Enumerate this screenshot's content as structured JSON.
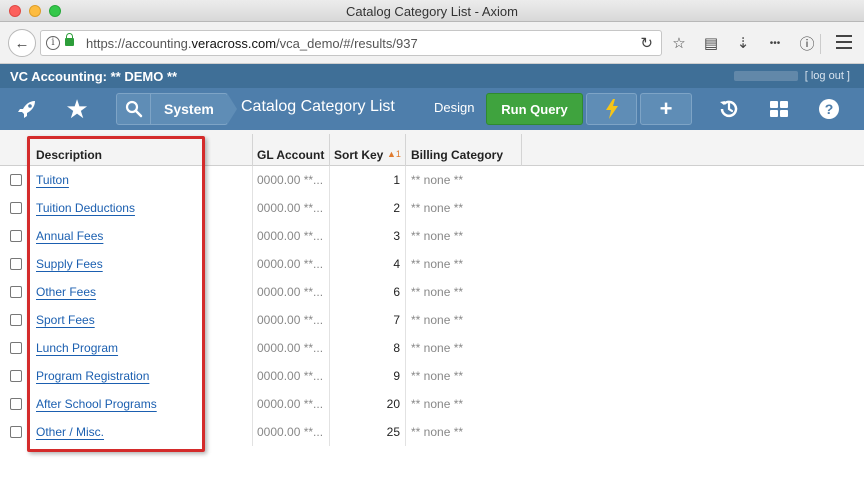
{
  "window": {
    "title": "Catalog Category List - Axiom"
  },
  "browser": {
    "url_prefix": "https://accounting.",
    "url_domain": "veracross.com",
    "url_path": "/vca_demo/#/results/937"
  },
  "app": {
    "name": "VC Accounting: ** DEMO **",
    "logout_label": "[ log out ]"
  },
  "nav": {
    "breadcrumb_system": "System",
    "page_title": "Catalog Category List",
    "design_label": "Design",
    "run_query_label": "Run Query"
  },
  "table": {
    "columns": [
      "Description",
      "GL Account",
      "Sort Key",
      "Billing Category"
    ],
    "sort_indicator": "1",
    "rows": [
      {
        "description": "Tuiton",
        "gl_account": "0000.00 **...",
        "sort_key": "1",
        "billing_category": "** none **"
      },
      {
        "description": "Tuition Deductions",
        "gl_account": "0000.00 **...",
        "sort_key": "2",
        "billing_category": "** none **"
      },
      {
        "description": "Annual Fees",
        "gl_account": "0000.00 **...",
        "sort_key": "3",
        "billing_category": "** none **"
      },
      {
        "description": "Supply Fees",
        "gl_account": "0000.00 **...",
        "sort_key": "4",
        "billing_category": "** none **"
      },
      {
        "description": "Other Fees",
        "gl_account": "0000.00 **...",
        "sort_key": "6",
        "billing_category": "** none **"
      },
      {
        "description": "Sport Fees",
        "gl_account": "0000.00 **...",
        "sort_key": "7",
        "billing_category": "** none **"
      },
      {
        "description": "Lunch Program",
        "gl_account": "0000.00 **...",
        "sort_key": "8",
        "billing_category": "** none **"
      },
      {
        "description": "Program Registration",
        "gl_account": "0000.00 **...",
        "sort_key": "9",
        "billing_category": "** none **"
      },
      {
        "description": "After School Programs",
        "gl_account": "0000.00 **...",
        "sort_key": "20",
        "billing_category": "** none **"
      },
      {
        "description": "Other / Misc.",
        "gl_account": "0000.00 **...",
        "sort_key": "25",
        "billing_category": "** none **"
      }
    ]
  },
  "colors": {
    "app_header": "#3f6f97",
    "nav_bar": "#4e7eab",
    "run_query": "#3fa33e",
    "link": "#1b5fb0",
    "highlight": "#d42b2b"
  }
}
